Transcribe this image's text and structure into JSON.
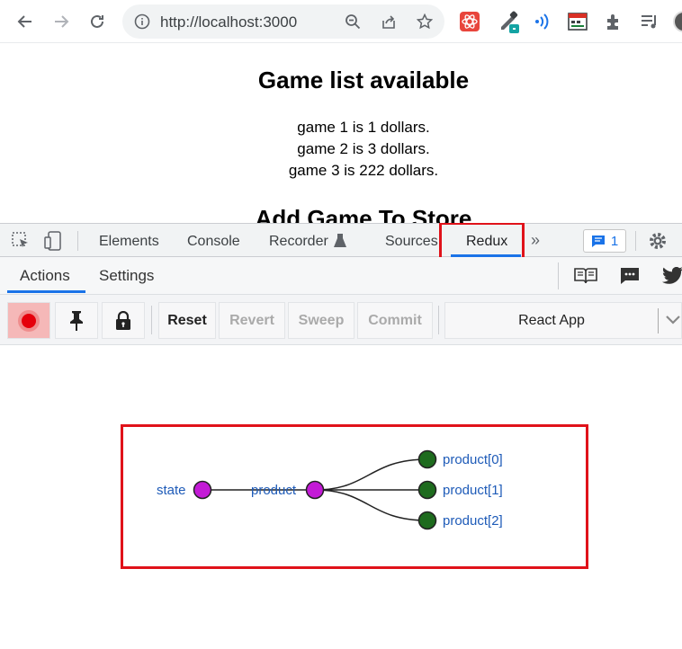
{
  "browser": {
    "url": "http://localhost:3000",
    "icons": [
      "back-icon",
      "forward-icon",
      "reload-icon",
      "info-icon",
      "zoom-icon",
      "share-icon",
      "star-icon",
      "react-devtools-icon",
      "eyedropper-icon",
      "wireless-icon",
      "calendar-ext-icon",
      "extensions-icon",
      "reading-list-icon",
      "profile-avatar"
    ]
  },
  "page": {
    "title": "Game list available",
    "games": [
      "game 1 is 1 dollars.",
      "game 2 is 3 dollars.",
      "game 3 is 222 dollars."
    ],
    "section_heading": "Add Game To Store"
  },
  "devtools": {
    "tabs": [
      "Elements",
      "Console",
      "Recorder",
      "Sources",
      "Redux"
    ],
    "active_tab": "Redux",
    "issues_count": "1",
    "accent": "#1a73e8",
    "highlight_color": "#e0121a"
  },
  "redux": {
    "sub_tabs": [
      "Actions",
      "Settings"
    ],
    "active_sub_tab": "Actions",
    "buttons": {
      "reset": "Reset",
      "revert": "Revert",
      "sweep": "Sweep",
      "commit": "Commit"
    },
    "instance": "React App",
    "tree": {
      "root": "state",
      "child": "product",
      "leaves": [
        "product[0]",
        "product[1]",
        "product[2]"
      ],
      "branch_node_color": "#c31ad6",
      "leaf_node_color": "#1e6b1e"
    }
  }
}
